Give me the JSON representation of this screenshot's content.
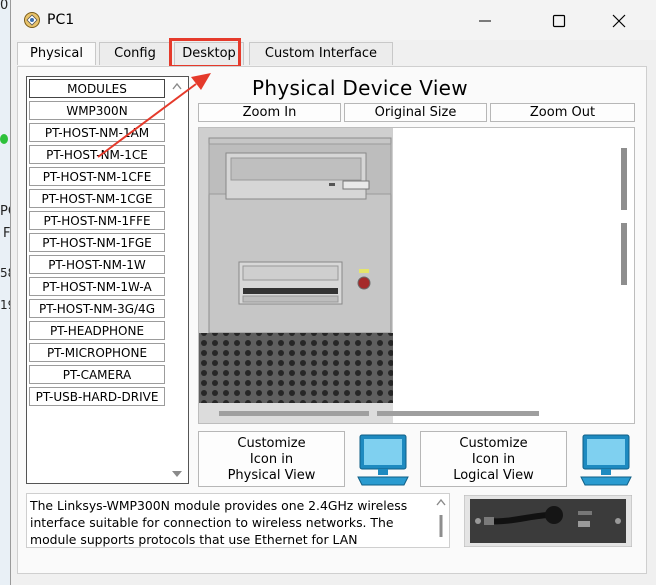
{
  "window": {
    "title": "PC1"
  },
  "tabs": [
    {
      "label": "Physical",
      "active": true
    },
    {
      "label": "Config",
      "active": false
    },
    {
      "label": "Desktop",
      "active": false,
      "highlighted": true
    },
    {
      "label": "Custom Interface",
      "active": false
    }
  ],
  "modules": [
    {
      "label": "MODULES"
    },
    {
      "label": "WMP300N"
    },
    {
      "label": "PT-HOST-NM-1AM"
    },
    {
      "label": "PT-HOST-NM-1CE"
    },
    {
      "label": "PT-HOST-NM-1CFE"
    },
    {
      "label": "PT-HOST-NM-1CGE"
    },
    {
      "label": "PT-HOST-NM-1FFE"
    },
    {
      "label": "PT-HOST-NM-1FGE"
    },
    {
      "label": "PT-HOST-NM-1W"
    },
    {
      "label": "PT-HOST-NM-1W-A"
    },
    {
      "label": "PT-HOST-NM-3G/4G"
    },
    {
      "label": "PT-HEADPHONE"
    },
    {
      "label": "PT-MICROPHONE"
    },
    {
      "label": "PT-CAMERA"
    },
    {
      "label": "PT-USB-HARD-DRIVE"
    }
  ],
  "view": {
    "heading": "Physical Device View",
    "zoom_in": "Zoom In",
    "original_size": "Original Size",
    "zoom_out": "Zoom Out"
  },
  "customize": {
    "physical": {
      "line1": "Customize",
      "line2": "Icon in",
      "line3": "Physical View"
    },
    "logical": {
      "line1": "Customize",
      "line2": "Icon in",
      "line3": "Logical View"
    }
  },
  "description": "The Linksys-WMP300N module provides one 2.4GHz wireless interface suitable for connection to wireless networks. The module supports protocols that use Ethernet for LAN",
  "background_fragments": [
    "0",
    "PC",
    "F",
    "58",
    "19"
  ],
  "icons": {
    "app": "packet-tracer-icon",
    "pc": "pc-monitor-icon",
    "annotation": "red-arrow-icon"
  },
  "colors": {
    "highlight": "#e53a2b",
    "accent": "#1f8ec4"
  }
}
